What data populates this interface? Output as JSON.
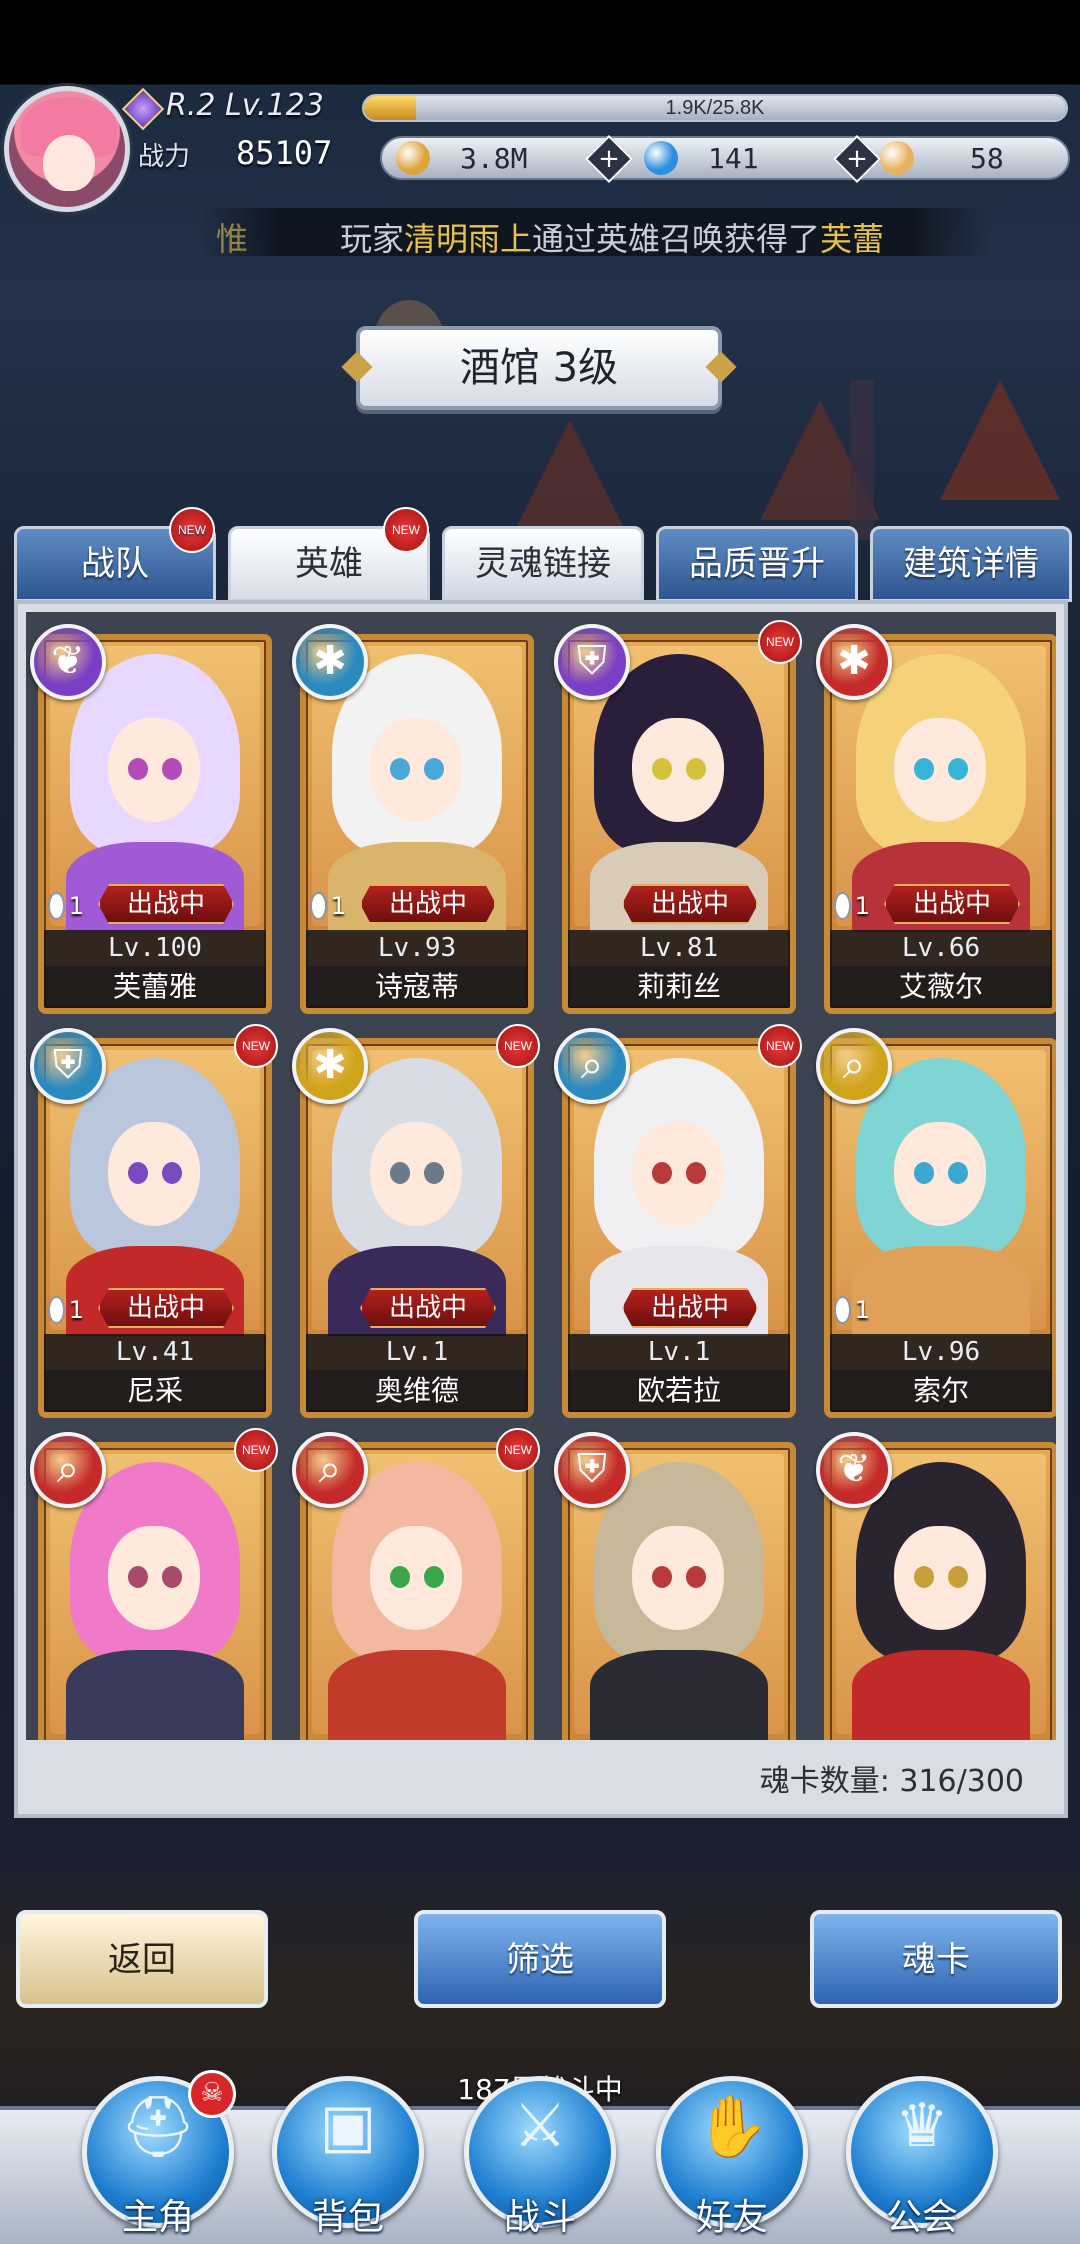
{
  "player": {
    "rank": "R.2",
    "level": "Lv.123",
    "exp_text": "1.9K/25.8K",
    "exp_fraction": 0.074,
    "power_label": "战力",
    "power_value": "85107"
  },
  "resources": [
    {
      "icon": "gold-coin-icon",
      "value": "3.8M",
      "color": "#e0a53a"
    },
    {
      "icon": "blue-gem-icon",
      "value": "141",
      "color": "#2b8fe0"
    },
    {
      "icon": "crystal-icon",
      "value": "58",
      "color": "#e8b35c"
    }
  ],
  "ticker": {
    "prefix": "惟",
    "text_before": "玩家",
    "player_name": "清明雨上",
    "text_middle": "通过英雄召唤获得了",
    "hero": "芙蕾"
  },
  "title": "酒馆 3级",
  "tabs": [
    {
      "label": "战队",
      "new": true
    },
    {
      "label": "英雄",
      "new": true
    },
    {
      "label": "灵魂链接",
      "new": false
    },
    {
      "label": "品质晋升",
      "new": false
    },
    {
      "label": "建筑详情",
      "new": false
    }
  ],
  "new_badge_text": "NEW",
  "cards": [
    {
      "name": "芙蕾雅",
      "level": "Lv.100",
      "deployed": "出战中",
      "copies": "1",
      "class_icon": "wing-class-icon",
      "class_color": "#7a3fc4",
      "new": false,
      "hair": "#e8d8ff",
      "accent": "#a05ad6",
      "eye": "#b24ab8"
    },
    {
      "name": "诗寇蒂",
      "level": "Lv.93",
      "deployed": "出战中",
      "copies": "1",
      "class_icon": "shuriken-class-icon",
      "class_color": "#2a8ac0",
      "new": false,
      "hair": "#f2f2f2",
      "accent": "#d9b46a",
      "eye": "#4aa8d8"
    },
    {
      "name": "莉莉丝",
      "level": "Lv.81",
      "deployed": "出战中",
      "copies": "",
      "class_icon": "shield-class-icon",
      "class_color": "#7a3fc4",
      "new": true,
      "hair": "#2a1f3a",
      "accent": "#d8ccb8",
      "eye": "#d4c23a"
    },
    {
      "name": "艾薇尔",
      "level": "Lv.66",
      "deployed": "出战中",
      "copies": "1",
      "class_icon": "shuriken-class-icon",
      "class_color": "#c42a2a",
      "new": false,
      "hair": "#f5d27a",
      "accent": "#b8323a",
      "eye": "#38b4d8"
    },
    {
      "name": "尼采",
      "level": "Lv.41",
      "deployed": "出战中",
      "copies": "1",
      "class_icon": "shield-class-icon",
      "class_color": "#2a8ac0",
      "new": true,
      "hair": "#b9c6dc",
      "accent": "#c22a2a",
      "eye": "#7a4ac0"
    },
    {
      "name": "奥维德",
      "level": "Lv.1",
      "deployed": "出战中",
      "copies": "",
      "class_icon": "shuriken-class-icon",
      "class_color": "#d0a41a",
      "new": true,
      "hair": "#d8dce4",
      "accent": "#3a2a5a",
      "eye": "#6a7a8a"
    },
    {
      "name": "欧若拉",
      "level": "Lv.1",
      "deployed": "出战中",
      "copies": "",
      "class_icon": "magnifier-class-icon",
      "class_color": "#2a8ac0",
      "new": true,
      "hair": "#f0f0f2",
      "accent": "#e6e6ec",
      "eye": "#b83a3a"
    },
    {
      "name": "索尔",
      "level": "Lv.96",
      "deployed": "",
      "copies": "1",
      "class_icon": "magnifier-class-icon",
      "class_color": "#d0a41a",
      "new": false,
      "hair": "#7fd4d4",
      "accent": "#e0a05a",
      "eye": "#3aa8d0"
    },
    {
      "name": "",
      "level": "",
      "deployed": "",
      "copies": "",
      "class_icon": "magnifier-class-icon",
      "class_color": "#c42a2a",
      "new": true,
      "hair": "#f07ac8",
      "accent": "#3a3a5a",
      "eye": "#a84a6a"
    },
    {
      "name": "",
      "level": "",
      "deployed": "",
      "copies": "",
      "class_icon": "magnifier-class-icon",
      "class_color": "#c42a2a",
      "new": true,
      "hair": "#f2b8a0",
      "accent": "#c23a2a",
      "eye": "#3aa84a"
    },
    {
      "name": "",
      "level": "",
      "deployed": "",
      "copies": "",
      "class_icon": "shield-class-icon",
      "class_color": "#c42a2a",
      "new": false,
      "hair": "#c8b89a",
      "accent": "#2a2a34",
      "eye": "#b83a3a"
    },
    {
      "name": "",
      "level": "",
      "deployed": "",
      "copies": "",
      "class_icon": "wing-class-icon",
      "class_color": "#c42a2a",
      "new": false,
      "hair": "#2a2430",
      "accent": "#c22a2a",
      "eye": "#c8a03a"
    }
  ],
  "card_count_label": "魂卡数量:",
  "card_count_value": "316/300",
  "buttons": {
    "back": "返回",
    "filter": "筛选",
    "soul_card": "魂卡"
  },
  "floor_status": "187层战斗中",
  "nav": [
    {
      "label": "主角",
      "icon": "helmet-icon",
      "alert": true
    },
    {
      "label": "背包",
      "icon": "backpack-icon",
      "alert": false
    },
    {
      "label": "战斗",
      "icon": "crossed-swords-icon",
      "alert": false
    },
    {
      "label": "好友",
      "icon": "handshake-icon",
      "alert": false
    },
    {
      "label": "公会",
      "icon": "guild-crest-icon",
      "alert": false
    }
  ],
  "nav_alert_glyph": "☠"
}
